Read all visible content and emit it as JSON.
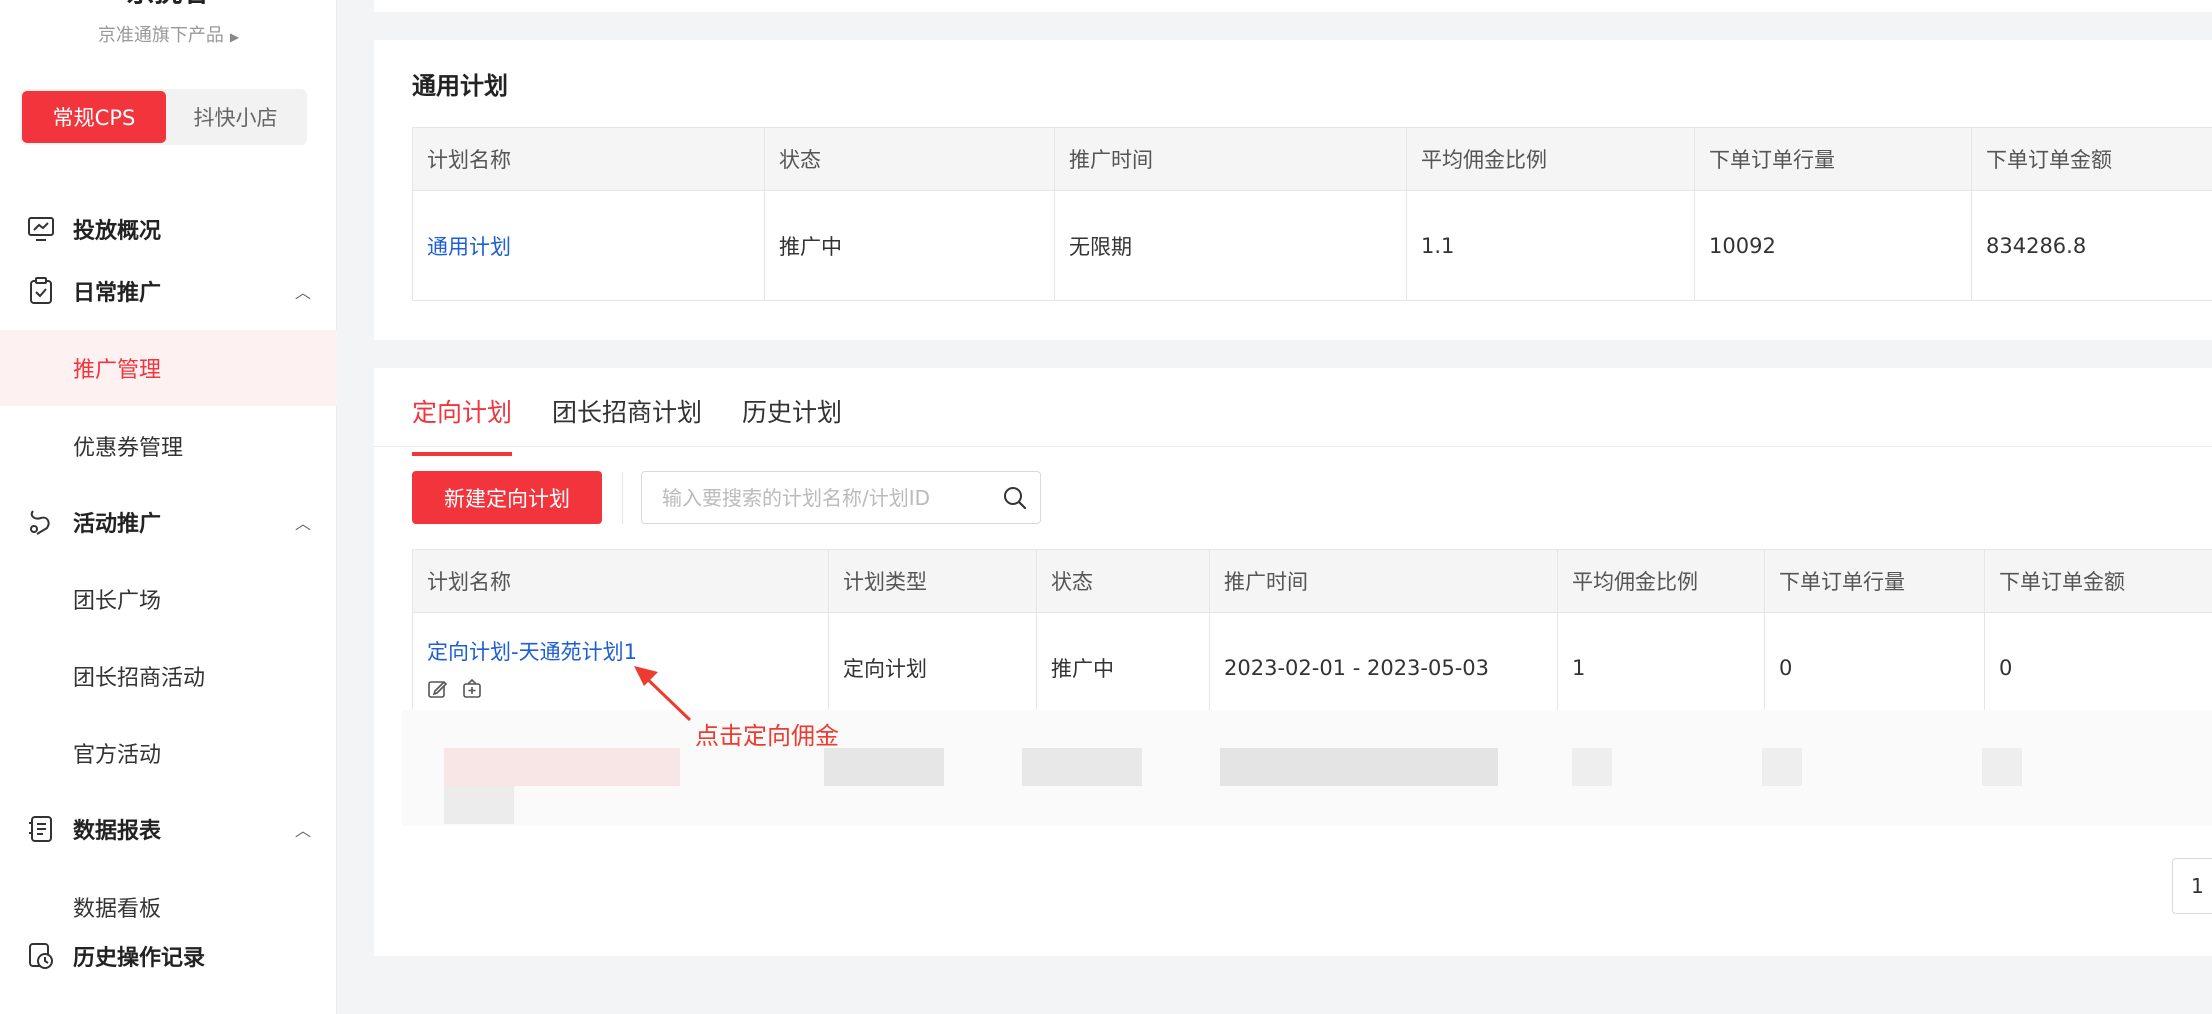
{
  "brand": {
    "name": "京挑客",
    "subtitle": "京准通旗下产品"
  },
  "segment": {
    "items": [
      "常规CPS",
      "抖快小店"
    ],
    "active": 0
  },
  "nav": {
    "overview": "投放概况",
    "daily": {
      "label": "日常推广",
      "sub": [
        "推广管理",
        "优惠券管理"
      ]
    },
    "activity": {
      "label": "活动推广",
      "sub": [
        "团长广场",
        "团长招商活动",
        "官方活动"
      ]
    },
    "report": {
      "label": "数据报表",
      "sub": [
        "数据看板"
      ]
    },
    "history": "历史操作记录"
  },
  "general": {
    "title": "通用计划",
    "headers": [
      "计划名称",
      "状态",
      "推广时间",
      "平均佣金比例",
      "下单订单行量",
      "下单订单金额"
    ],
    "row": {
      "name": "通用计划",
      "status": "推广中",
      "period": "无限期",
      "rate": "1.1",
      "orders": "10092",
      "amount": "834286.8"
    }
  },
  "targeted": {
    "tabs": [
      "定向计划",
      "团长招商计划",
      "历史计划"
    ],
    "active_tab": 0,
    "new_button": "新建定向计划",
    "search_placeholder": "输入要搜索的计划名称/计划ID",
    "headers": [
      "计划名称",
      "计划类型",
      "状态",
      "推广时间",
      "平均佣金比例",
      "下单订单行量",
      "下单订单金额"
    ],
    "row": {
      "name": "定向计划-天通苑计划1",
      "type": "定向计划",
      "status": "推广中",
      "period": "2023-02-01 - 2023-05-03",
      "rate": "1",
      "orders": "0",
      "amount": "0"
    }
  },
  "annotation": "点击定向佣金",
  "pager": {
    "current": "1"
  },
  "colors": {
    "accent": "#f2353c",
    "link": "#1e5fd6",
    "annotation": "#ee3b30"
  },
  "icons": [
    "chart-monitor-icon",
    "clipboard-check-icon",
    "activity-icon",
    "report-doc-icon",
    "history-clock-icon",
    "search-icon",
    "edit-icon",
    "commission-icon",
    "chevron-up-icon"
  ]
}
